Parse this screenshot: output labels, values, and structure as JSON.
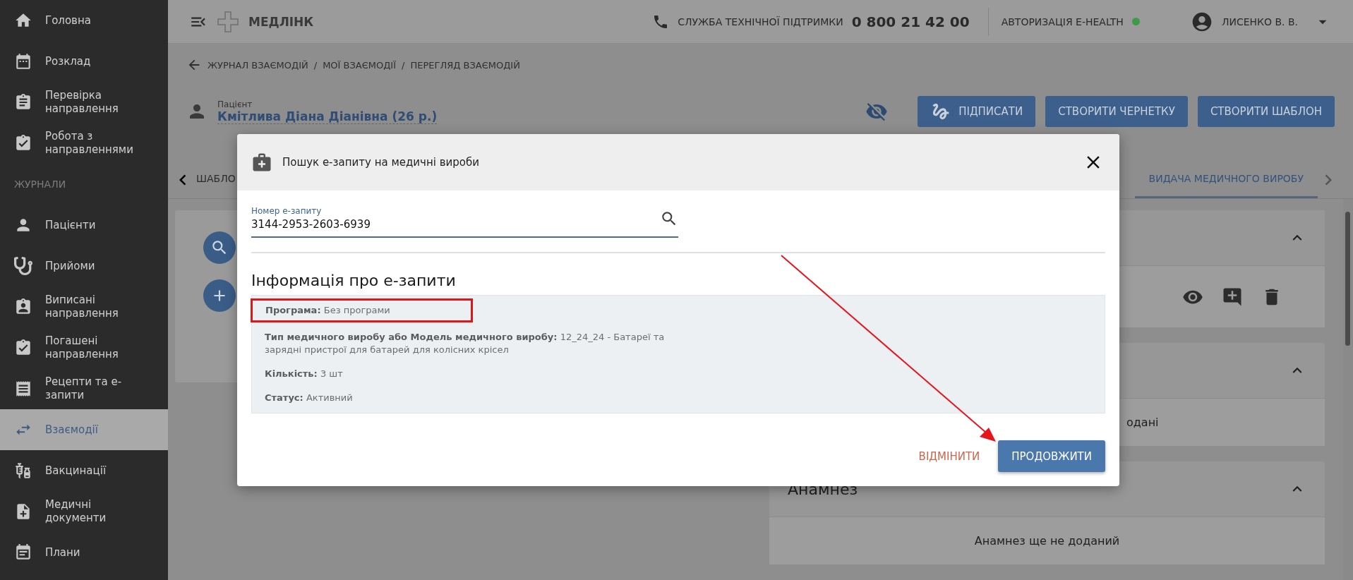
{
  "sidebar": {
    "items": [
      {
        "kind": "item",
        "label": "Головна",
        "selected": false
      },
      {
        "kind": "item",
        "label": "Розклад",
        "selected": false
      },
      {
        "kind": "item",
        "label": "Перевірка направлення",
        "selected": false
      },
      {
        "kind": "item",
        "label": "Робота з направленнями",
        "selected": false
      },
      {
        "kind": "section",
        "label": "ЖУРНАЛИ"
      },
      {
        "kind": "item",
        "label": "Пацієнти",
        "selected": false
      },
      {
        "kind": "item",
        "label": "Прийоми",
        "selected": false
      },
      {
        "kind": "item",
        "label": "Виписані направлення",
        "selected": false
      },
      {
        "kind": "item",
        "label": "Погашені направлення",
        "selected": false
      },
      {
        "kind": "item",
        "label": "Рецепти та е-запити",
        "selected": false
      },
      {
        "kind": "item",
        "label": "Взаємодії",
        "selected": true
      },
      {
        "kind": "item",
        "label": "Вакцинації",
        "selected": false
      },
      {
        "kind": "item",
        "label": "Медичні документи",
        "selected": false
      },
      {
        "kind": "item",
        "label": "Плани",
        "selected": false
      }
    ]
  },
  "topbar": {
    "brand": "МЕДЛІНК",
    "support_label": "СЛУЖБА ТЕХНІЧНОЇ ПІДТРИМКИ",
    "support_phone": "0 800 21 42 00",
    "auth_label": "АВТОРИЗАЦІЯ E-HEALTH",
    "auth_connected": true,
    "user": "ЛИСЕНКО В. В."
  },
  "breadcrumb": {
    "separator": "/",
    "items": [
      "ЖУРНАЛ ВЗАЄМОДІЙ",
      "МОЇ ВЗАЄМОДІЇ",
      "ПЕРЕГЛЯД ВЗАЄМОДІЙ"
    ]
  },
  "patient": {
    "label": "Пацієнт",
    "name": "Кмітлива Діана Діанівна (26 р.)"
  },
  "actions": [
    {
      "kind": "sign",
      "label": "ПІДПИСАТИ"
    },
    {
      "kind": "plain",
      "label": "СТВОРИТИ ЧЕРНЕТКУ"
    },
    {
      "kind": "plain",
      "label": "СТВОРИТИ ШАБЛОН"
    }
  ],
  "tabs": [
    {
      "label": "ШАБЛО",
      "selected": false
    },
    {
      "label": "ВИДАЧА МЕДИЧНОГО ВИРОБУ",
      "selected": true
    }
  ],
  "cards": [
    {
      "kind": "actions",
      "expanded": true
    },
    {
      "kind": "text",
      "text": "одані",
      "expanded": true
    },
    {
      "kind": "titled",
      "title": "Анамнез",
      "text": "Анамнез ще не доданий",
      "expanded": true
    }
  ],
  "dialog": {
    "title": "Пошук е-запиту на медичні вироби",
    "field": {
      "label": "Номер е-запиту",
      "value": "3144-2953-2603-6939"
    },
    "section_title": "Інформація про е-запити",
    "details": [
      {
        "label": "Програма:",
        "value": "Без програми",
        "highlighted": true
      },
      {
        "label": "Тип медичного виробу або Модель медичного виробу:",
        "value": "12_24_24 - Батареї та зарядні пристрої для батарей для колісних крісел",
        "highlighted": false
      },
      {
        "label": "Кількість:",
        "value": "3 шт",
        "highlighted": false
      },
      {
        "label": "Статус:",
        "value": "Активний",
        "highlighted": false
      }
    ],
    "buttons": [
      {
        "kind": "text",
        "label": "ВІДМІНИТИ"
      },
      {
        "kind": "primary",
        "label": "ПРОДОВЖИТИ"
      }
    ]
  }
}
